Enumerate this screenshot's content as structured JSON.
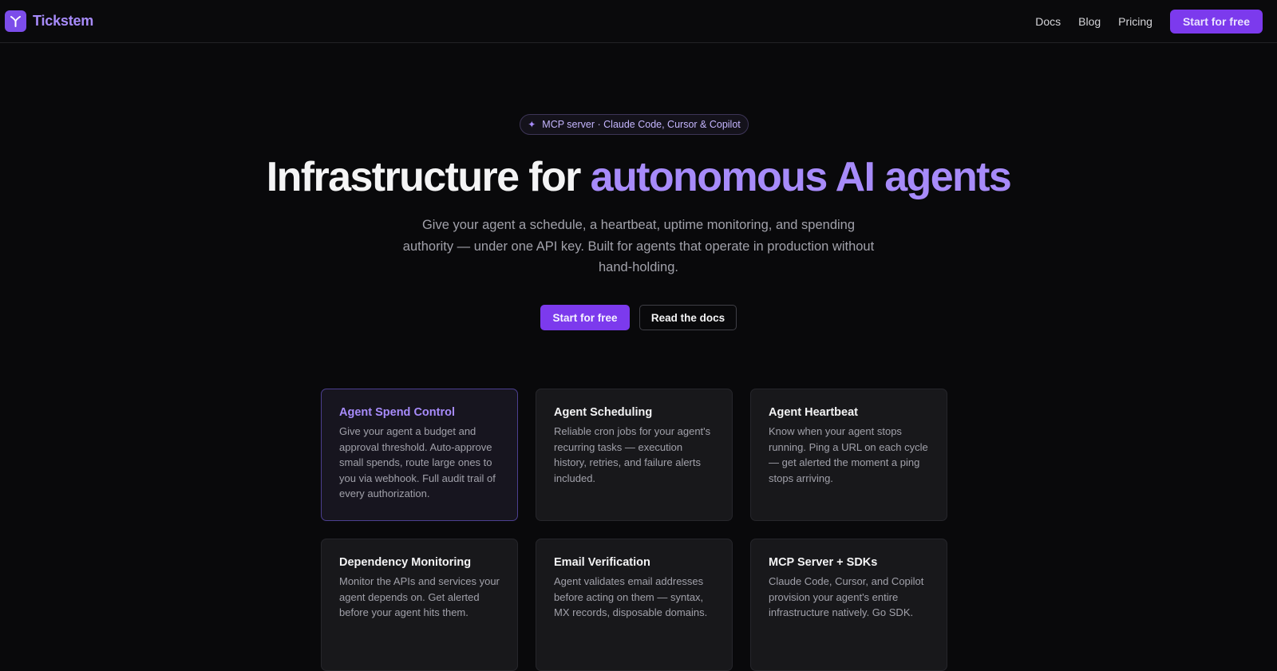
{
  "nav": {
    "brand": "Tickstem",
    "links": [
      "Docs",
      "Blog",
      "Pricing"
    ],
    "cta": "Start for free"
  },
  "hero": {
    "badge": "MCP server · Claude Code, Cursor & Copilot",
    "title_prefix": "Infrastructure for ",
    "title_accent": "autonomous AI agents",
    "subtitle": "Give your agent a schedule, a heartbeat, uptime monitoring, and spending authority — under one API key. Built for agents that operate in production without hand-holding.",
    "primary_cta": "Start for free",
    "secondary_cta": "Read the docs"
  },
  "colors": {
    "accent": "#a78bfa",
    "button": "#7c3aed",
    "background": "#09090b"
  },
  "features": [
    {
      "title": "Agent Spend Control",
      "desc": "Give your agent a budget and approval threshold. Auto-approve small spends, route large ones to you via webhook. Full audit trail of every authorization.",
      "active": true
    },
    {
      "title": "Agent Scheduling",
      "desc": "Reliable cron jobs for your agent's recurring tasks — execution history, retries, and failure alerts included."
    },
    {
      "title": "Agent Heartbeat",
      "desc": "Know when your agent stops running. Ping a URL on each cycle — get alerted the moment a ping stops arriving."
    },
    {
      "title": "Dependency Monitoring",
      "desc": "Monitor the APIs and services your agent depends on. Get alerted before your agent hits them."
    },
    {
      "title": "Email Verification",
      "desc": "Agent validates email addresses before acting on them — syntax, MX records, disposable domains."
    },
    {
      "title": "MCP Server + SDKs",
      "desc": "Claude Code, Cursor, and Copilot provision your agent's entire infrastructure natively. Go SDK."
    }
  ]
}
